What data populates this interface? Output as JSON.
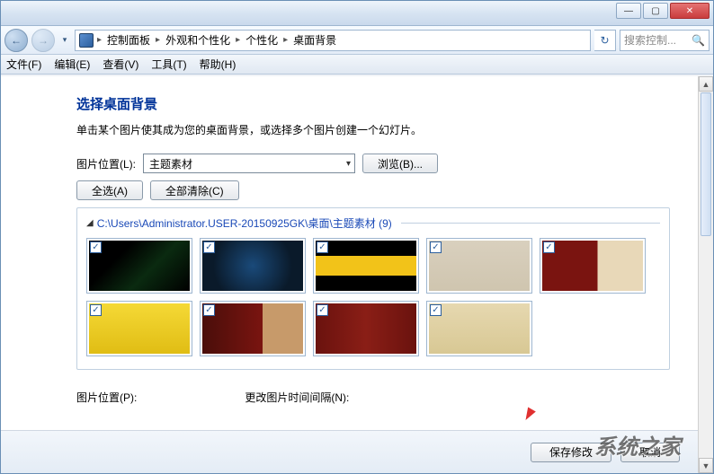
{
  "titlebar": {
    "min": "—",
    "max": "▢",
    "close": "✕"
  },
  "nav": {
    "back": "←",
    "fwd": "→",
    "drop": "▾",
    "crumbs": [
      "控制面板",
      "外观和个性化",
      "个性化",
      "桌面背景"
    ],
    "sep": "▸",
    "refresh": "↻",
    "search_placeholder": "搜索控制..."
  },
  "menu": {
    "file": "文件(F)",
    "edit": "编辑(E)",
    "view": "查看(V)",
    "tools": "工具(T)",
    "help": "帮助(H)"
  },
  "page": {
    "title": "选择桌面背景",
    "desc": "单击某个图片使其成为您的桌面背景，或选择多个图片创建一个幻灯片。",
    "loc_label": "图片位置(L):",
    "loc_value": "主题素材",
    "browse": "浏览(B)...",
    "select_all": "全选(A)",
    "clear_all": "全部清除(C)",
    "group_path": "C:\\Users\\Administrator.USER-20150925GK\\桌面\\主题素材 (9)",
    "pos_label": "图片位置(P):",
    "interval_label": "更改图片时间间隔(N):",
    "save": "保存修改",
    "cancel": "取消"
  },
  "thumbs": [
    {
      "bg": "linear-gradient(135deg,#000 30%,#0a2a10 60%,#000 100%)"
    },
    {
      "bg": "radial-gradient(circle at 50% 50%,#1a4a7a,#0a1a2a 70%)"
    },
    {
      "bg": "linear-gradient(#000 0%,#000 30%,#f2c319 30%,#f2c319 70%,#000 70%)"
    },
    {
      "bg": "linear-gradient(#d9d0be,#cfc5af)"
    },
    {
      "bg": "linear-gradient(to right,#7a1410 0%,#7a1410 55%,#e8d8b8 55%)"
    },
    {
      "bg": "linear-gradient(#f5d936,#e0bd14)"
    },
    {
      "bg": "linear-gradient(to right,#4a0e0a,#7a1410 60%,#c79a6a 60%)"
    },
    {
      "bg": "linear-gradient(to right,#6a120e,#8a1e16 50%,#6a120e)"
    },
    {
      "bg": "linear-gradient(#e6d8b0,#d8c894)"
    }
  ],
  "watermark": "系统之家",
  "colors": {
    "link": "#003399"
  }
}
